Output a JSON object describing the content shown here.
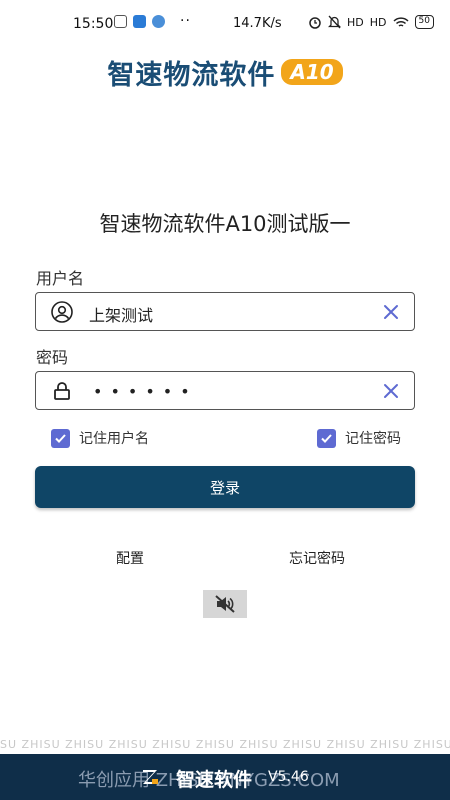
{
  "status_bar": {
    "time": "15:50",
    "dots": "··",
    "network_speed": "14.7K/s",
    "signal_1": "HD",
    "signal_2": "HD",
    "battery": "50"
  },
  "logo": {
    "text": "智速物流软件",
    "badge": "A10"
  },
  "app_title": "智速物流软件A10测试版一",
  "username": {
    "label": "用户名",
    "value": "上架测试"
  },
  "password": {
    "label": "密码",
    "masked_value": "••••••"
  },
  "remember_username": {
    "label": "记住用户名",
    "checked": true
  },
  "remember_password": {
    "label": "记住密码",
    "checked": true
  },
  "login_button": "登录",
  "config_link": "配置",
  "forgot_link": "忘记密码",
  "watermark": "SU ZHISU ZHISU ZHISU ZHISU ZHISU ZHISU ZHISU ZHISU ZHISU ZHISU ZHISU ZH",
  "footer": {
    "overlay_text": "华创应用 ZHISU ANYGZS.COM",
    "brand": "智速软件",
    "version": "V5.46"
  },
  "colors": {
    "primary": "#0f4566",
    "accent": "#5e6ad2",
    "logo_badge": "#f2a51a",
    "footer_bg": "#0f2e49"
  }
}
